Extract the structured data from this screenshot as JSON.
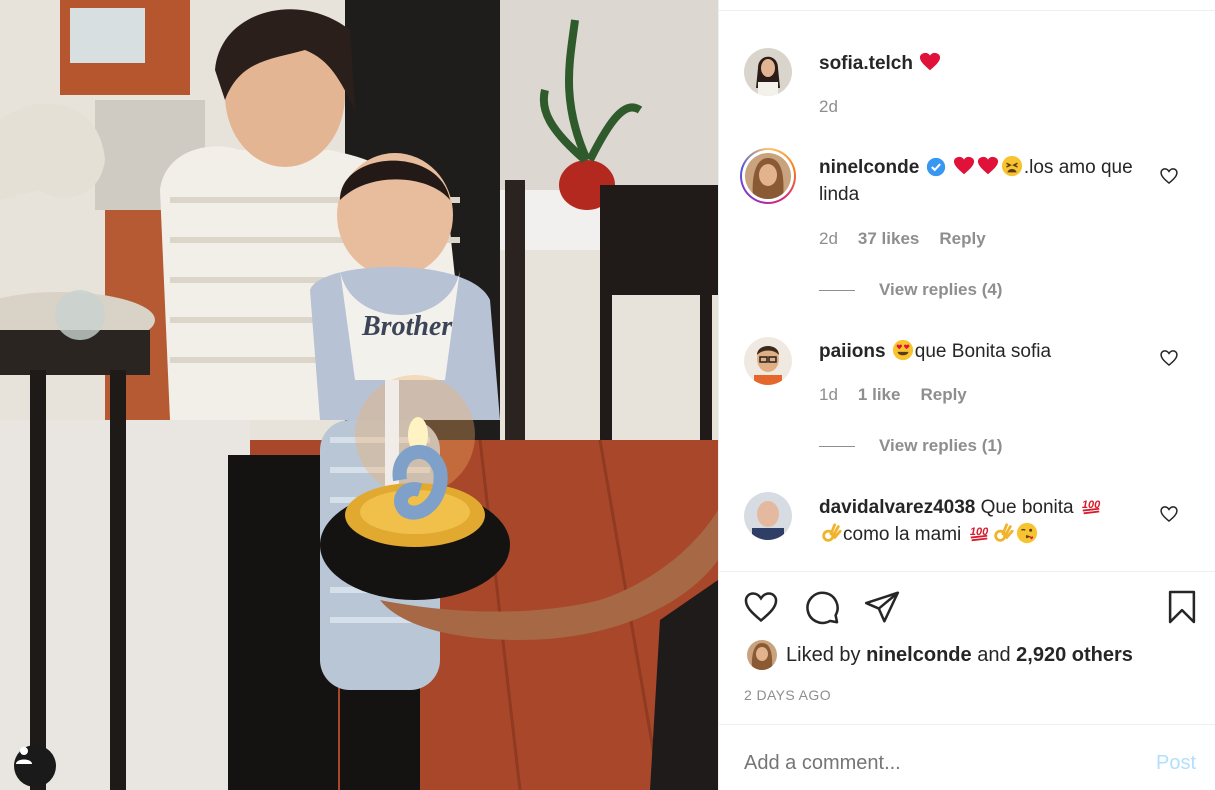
{
  "post": {
    "photo_alt": "",
    "caption": {
      "username": "sofia.telch",
      "emoji": "red-heart",
      "time": "2d"
    }
  },
  "comments": [
    {
      "username": "ninelconde",
      "verified": true,
      "text": ".los amo que linda",
      "emojis_before": [
        "red-heart",
        "red-heart",
        "tired-face"
      ],
      "time": "2d",
      "likes": "37 likes",
      "reply": "Reply",
      "view_replies": "View replies (4)",
      "story_ring": true
    },
    {
      "username": "paiions",
      "text": "que Bonita sofia",
      "emojis_before": [
        "heart-eyes"
      ],
      "time": "1d",
      "likes": "1 like",
      "reply": "Reply",
      "view_replies": "View replies (1)"
    },
    {
      "username": "davidalvarez4038",
      "text_part1": "Que bonita",
      "text_part2": "como la mami",
      "time": "",
      "emojis": [
        "hundred",
        "ok-hand",
        "hundred",
        "ok-hand",
        "winking-kiss"
      ]
    }
  ],
  "actions": {
    "like_icon": "heart-outline-icon",
    "comment_icon": "speech-bubble-icon",
    "share_icon": "paper-plane-icon",
    "save_icon": "bookmark-icon"
  },
  "likes_summary": {
    "prefix": "Liked by",
    "user": "ninelconde",
    "and": "and",
    "others": "2,920 others"
  },
  "timestamp": "2 DAYS AGO",
  "comment_box": {
    "placeholder": "Add a comment...",
    "post_label": "Post"
  },
  "colors": {
    "text": "#262626",
    "muted": "#8e8e8e",
    "post_disabled": "#b2dffc",
    "verified": "#3897f0"
  }
}
